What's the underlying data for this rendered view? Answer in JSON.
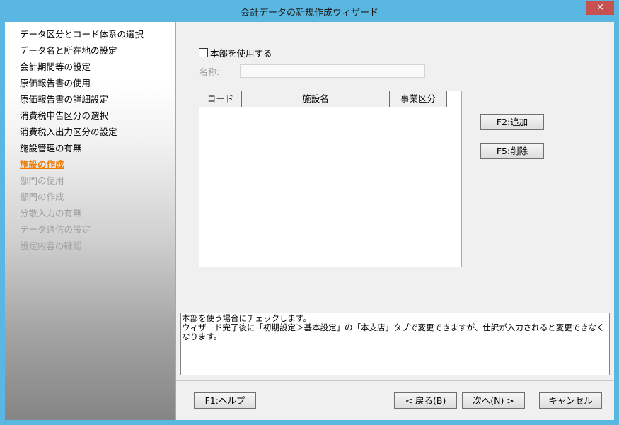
{
  "window": {
    "title": "会計データの新規作成ウィザード",
    "close_label": "×"
  },
  "steps": [
    {
      "label": "データ区分とコード体系の選択",
      "state": "done"
    },
    {
      "label": "データ名と所在地の設定",
      "state": "done"
    },
    {
      "label": "会計期間等の設定",
      "state": "done"
    },
    {
      "label": "原価報告書の使用",
      "state": "done"
    },
    {
      "label": "原価報告書の詳細設定",
      "state": "done"
    },
    {
      "label": "消費税申告区分の選択",
      "state": "done"
    },
    {
      "label": "消費税入出力区分の設定",
      "state": "done"
    },
    {
      "label": "施設管理の有無",
      "state": "done"
    },
    {
      "label": "施設の作成",
      "state": "current"
    },
    {
      "label": "部門の使用",
      "state": "pending"
    },
    {
      "label": "部門の作成",
      "state": "pending"
    },
    {
      "label": "分散入力の有無",
      "state": "pending"
    },
    {
      "label": "データ通信の設定",
      "state": "pending"
    },
    {
      "label": "設定内容の確認",
      "state": "pending"
    }
  ],
  "form": {
    "use_hq_label": "本部を使用する",
    "use_hq_checked": false,
    "name_label": "名称:",
    "name_value": ""
  },
  "grid": {
    "columns": [
      "コード",
      "施設名",
      "事業区分"
    ],
    "rows": []
  },
  "buttons": {
    "add": "F2:追加",
    "delete": "F5:削除",
    "help": "F1:ヘルプ",
    "back": "< 戻る(B)",
    "next": "次へ(N) >",
    "cancel": "キャンセル"
  },
  "help_text": {
    "line1": "本部を使う場合にチェックします。",
    "line2": "ウィザード完了後に「初期設定＞基本設定」の「本支店」タブで変更できますが、仕訳が入力されると変更できなくなります。"
  },
  "colors": {
    "titlebar": "#5ab7e2",
    "current_step": "#f07a00",
    "pending_step": "#a0a0a0",
    "close_button": "#c75050"
  }
}
